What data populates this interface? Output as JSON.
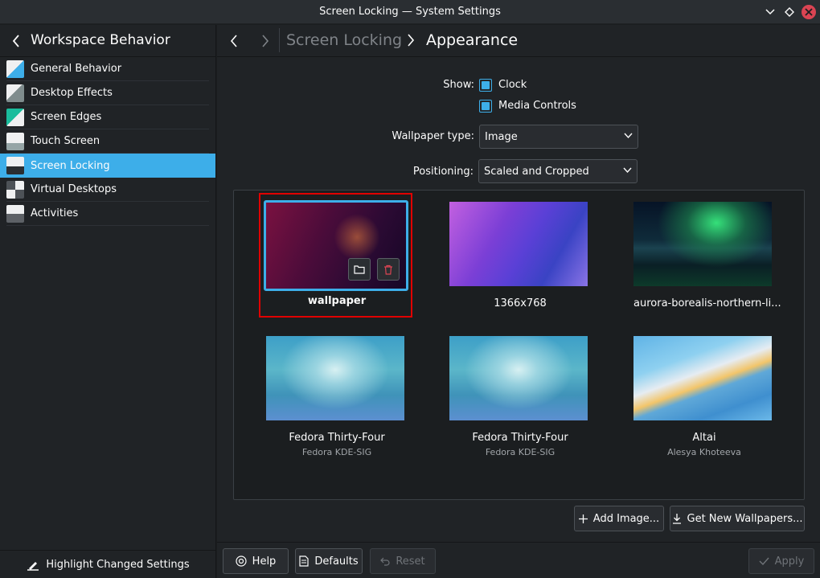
{
  "window": {
    "title": "Screen Locking — System Settings"
  },
  "sidebar": {
    "title": "Workspace Behavior",
    "items": [
      {
        "label": "General Behavior",
        "icon": "general-behavior-icon",
        "color": "#3daee9"
      },
      {
        "label": "Desktop Effects",
        "icon": "desktop-effects-icon",
        "color": "#7f8c8d"
      },
      {
        "label": "Screen Edges",
        "icon": "screen-edges-icon",
        "color": "#1abc9c"
      },
      {
        "label": "Touch Screen",
        "icon": "touch-screen-icon",
        "color": "#95a5a6"
      },
      {
        "label": "Screen Locking",
        "icon": "screen-locking-icon",
        "color": "#3daee9",
        "active": true
      },
      {
        "label": "Virtual Desktops",
        "icon": "virtual-desktops-icon",
        "color": "#4d5257"
      },
      {
        "label": "Activities",
        "icon": "activities-icon",
        "color": "#5d6166"
      }
    ],
    "footer_label": "Highlight Changed Settings"
  },
  "breadcrumb": {
    "parent": "Screen Locking",
    "current": "Appearance"
  },
  "form": {
    "show_label": "Show:",
    "clock_label": "Clock",
    "clock_checked": true,
    "media_label": "Media Controls",
    "media_checked": true,
    "wallpaper_type_label": "Wallpaper type:",
    "wallpaper_type_value": "Image",
    "positioning_label": "Positioning:",
    "positioning_value": "Scaled and Cropped"
  },
  "wallpapers": [
    {
      "name": "wallpaper",
      "author": "",
      "selected": true
    },
    {
      "name": "1366x768",
      "author": ""
    },
    {
      "name": "aurora-borealis-northern-li...",
      "author": ""
    },
    {
      "name": "Fedora Thirty-Four",
      "author": "Fedora KDE-SIG"
    },
    {
      "name": "Fedora Thirty-Four",
      "author": "Fedora KDE-SIG"
    },
    {
      "name": "Altai",
      "author": "Alesya Khoteeva"
    }
  ],
  "actions": {
    "add_image": "Add Image...",
    "get_new": "Get New Wallpapers..."
  },
  "bottom": {
    "help": "Help",
    "defaults": "Defaults",
    "reset": "Reset",
    "apply": "Apply"
  },
  "colors": {
    "accent": "#3daee9",
    "highlight_frame": "#e00000",
    "close": "#da4453"
  }
}
